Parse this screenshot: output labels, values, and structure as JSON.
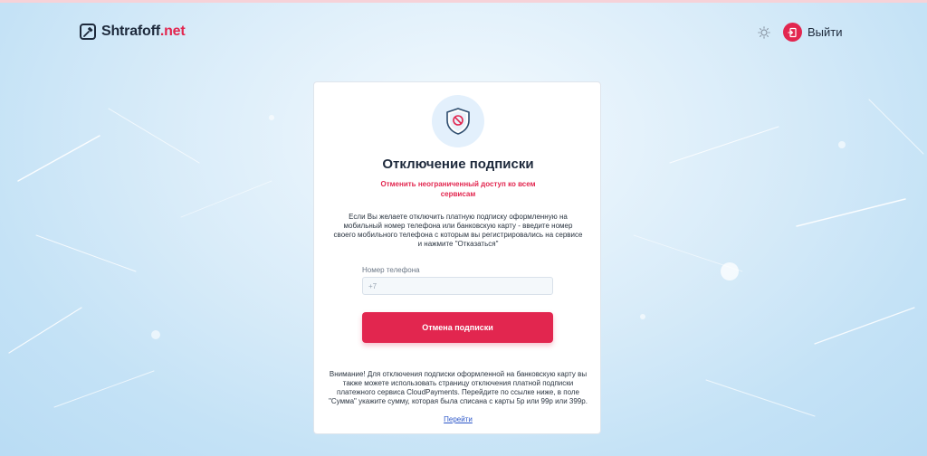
{
  "header": {
    "logo": {
      "prefix": "Shtrafoff",
      "suffix": ".net"
    },
    "theme_icon": "sun-icon",
    "logout_label": "Выйти",
    "logout_icon": "door-exit-icon"
  },
  "card": {
    "icon": "shield-blocked-icon",
    "title": "Отключение подписки",
    "subtitle": "Отменить неограниченный доступ ко всем сервисам",
    "description": "Если Вы желаете отключить платную подписку оформленную на мобильный номер телефона или банковскую карту - введите номер своего мобильного телефона с которым вы регистрировались на сервисе и нажмите \"Отказаться\"",
    "phone": {
      "label": "Номер телефона",
      "placeholder": "+7",
      "value": ""
    },
    "cancel_button": "Отмена подписки",
    "notice": "Внимание! Для отключения подписки оформленной на банковскую карту вы также можете использовать страницу отключения платной подписки платежного сервиса CloudPayments. Перейдите по ссылке ниже, в поле \"Сумма\" укажите сумму, которая была списана с карты 5р или 99р или 399р.",
    "notice_link": "Перейти"
  },
  "colors": {
    "accent": "#e2264f",
    "text": "#1e2a3c",
    "link": "#2c57c9",
    "icon_bg": "#e3f0fc"
  }
}
